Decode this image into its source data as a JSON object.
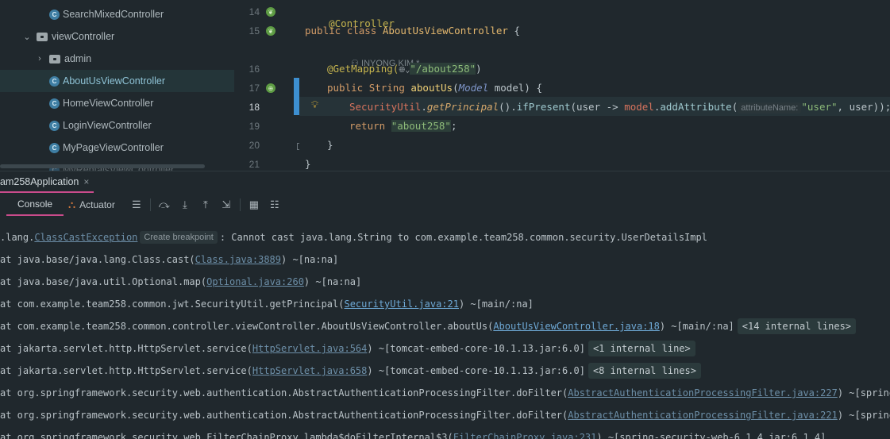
{
  "tree": {
    "items": [
      {
        "label": "SearchMixedController",
        "type": "class",
        "selected": false
      },
      {
        "label": "viewController",
        "type": "folder",
        "expanded": true
      },
      {
        "label": "admin",
        "type": "folder",
        "expanded": false
      },
      {
        "label": "AboutUsViewController",
        "type": "class",
        "selected": true
      },
      {
        "label": "HomeViewController",
        "type": "class",
        "selected": false
      },
      {
        "label": "LoginViewController",
        "type": "class",
        "selected": false
      },
      {
        "label": "MyPageViewController",
        "type": "class",
        "selected": false
      },
      {
        "label": "MyRentalsViewController",
        "type": "class",
        "selected": false
      }
    ]
  },
  "editor": {
    "line_numbers": [
      "14",
      "15",
      "16",
      "17",
      "18",
      "19",
      "20",
      "21"
    ],
    "current_line": "18",
    "author_hint": "INYONG KIM *",
    "lines": {
      "l14": {
        "annotation": "@Controller"
      },
      "l15": {
        "kw1": "public",
        "kw2": "class",
        "cls": "AboutUsViewController",
        "brace": " {"
      },
      "l16": {
        "annotation": "@GetMapping(",
        "path": "\"/about258\"",
        "close": ")"
      },
      "l17": {
        "kw1": "public",
        "type": "String",
        "method": "aboutUs",
        "p_open": "(",
        "param_type": "Model",
        "param": " model) {"
      },
      "l18": {
        "cls": "SecurityUtil",
        "dot1": ".",
        "static_call": "getPrincipal",
        "mid1": "().",
        "call2": "ifPresent",
        "mid2": "(user -> ",
        "model": "model",
        "dot2": ".",
        "call3": "addAttribute",
        "open": "(",
        "hint": "attributeName:",
        "arg": "\"user\"",
        "tail": ", user));"
      },
      "l19": {
        "kw": "return",
        "space": " ",
        "str": "\"about258\"",
        "semi": ";"
      },
      "l20": {
        "brace": "}"
      },
      "l21": {
        "brace": "}"
      }
    }
  },
  "run": {
    "tab_label": "am258Application",
    "close_icon": "×"
  },
  "console_toolbar": {
    "console_label": "Console",
    "actuator_label": "Actuator"
  },
  "console": {
    "l1": {
      "pre": ".lang.",
      "link": "ClassCastException",
      "badge": "Create breakpoint",
      "post": ": Cannot cast java.lang.String to com.example.team258.common.security.UserDetailsImpl"
    },
    "l2": {
      "pre": "at java.base/java.lang.Class.cast(",
      "link": "Class.java:3889",
      "post": ") ~[na:na]"
    },
    "l3": {
      "pre": "at java.base/java.util.Optional.map(",
      "link": "Optional.java:260",
      "post": ") ~[na:na]"
    },
    "l4": {
      "pre": "at com.example.team258.common.jwt.SecurityUtil.getPrincipal(",
      "link": "SecurityUtil.java:21",
      "post": ") ~[main/:na]"
    },
    "l5": {
      "pre": "at com.example.team258.common.controller.viewController.AboutUsViewController.aboutUs(",
      "link": "AboutUsViewController.java:18",
      "post": ") ~[main/:na]",
      "fold": "<14 internal lines>"
    },
    "l6": {
      "pre": "at jakarta.servlet.http.HttpServlet.service(",
      "link": "HttpServlet.java:564",
      "post": ") ~[tomcat-embed-core-10.1.13.jar:6.0]",
      "fold": "<1 internal line>"
    },
    "l7": {
      "pre": "at jakarta.servlet.http.HttpServlet.service(",
      "link": "HttpServlet.java:658",
      "post": ") ~[tomcat-embed-core-10.1.13.jar:6.0]",
      "fold": "<8 internal lines>"
    },
    "l8": {
      "pre": "at org.springframework.security.web.authentication.AbstractAuthenticationProcessingFilter.doFilter(",
      "link": "AbstractAuthenticationProcessingFilter.java:227",
      "post": ") ~[spring-sec"
    },
    "l9": {
      "pre": "at org.springframework.security.web.authentication.AbstractAuthenticationProcessingFilter.doFilter(",
      "link": "AbstractAuthenticationProcessingFilter.java:221",
      "post": ") ~[spring-sec"
    },
    "l10": {
      "pre": "at org.springframework.security.web.FilterChainProxy.lambda$doFilterInternal$3(",
      "link": "FilterChainProxy.java:231",
      "post": ") ~[spring-security-web-6.1.4.jar:6.1.4]"
    }
  }
}
